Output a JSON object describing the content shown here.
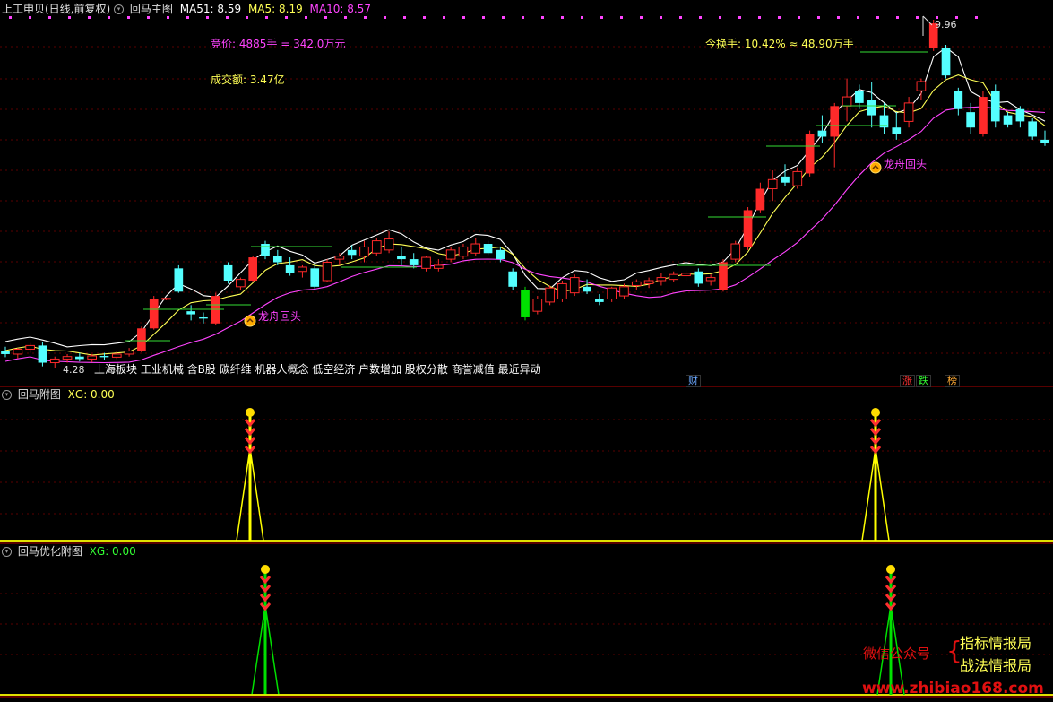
{
  "header": {
    "stock_title": "上工申贝(日线,前复权)",
    "indicator_name": "回马主图",
    "ma51_label": "MA51: 8.59",
    "ma5_label": "MA5: 8.19",
    "ma10_label": "MA10: 8.57"
  },
  "main_panel": {
    "auction": "竞价: 4885手 = 342.0万元",
    "turnover_amount": "成交额: 3.47亿",
    "turnover_rate": "今换手: 10.42% ≈ 48.90万手",
    "high_price": "9.96",
    "low_price": "4.28",
    "concepts": "上海板块 工业机械 含B股 碳纤维 机器人概念 低空经济 户数增加 股权分散 商誉减值 最近异动",
    "signal_label_1": "龙舟回头",
    "signal_label_2": "龙舟回头",
    "badge_cai": "财",
    "badge_zhang": "涨",
    "badge_die": "跌",
    "badge_bang": "榜"
  },
  "sub_panel_1": {
    "title": "回马附图",
    "xg_label": "XG: 0.00"
  },
  "sub_panel_2": {
    "title": "回马优化附图",
    "xg_label": "XG: 0.00"
  },
  "watermark": {
    "wechat_label": "微信公众号",
    "name_1": "指标情报局",
    "name_2": "战法情报局",
    "url": "www.zhibiao168.com"
  },
  "colors": {
    "up": "#ff2a2a",
    "down": "#54ffff",
    "big_down": "#00e000",
    "ma5": "#ffffff",
    "ma10": "#ffff55",
    "ma51": "#ff44ff",
    "signal": "#ffff00",
    "signal2": "#00e000"
  },
  "chart_data": {
    "type": "candlestick",
    "title": "上工申贝(日线,前复权)",
    "price_range": [
      4.28,
      9.96
    ],
    "candles": [
      [
        4.55,
        4.62,
        4.45,
        4.5
      ],
      [
        4.5,
        4.6,
        4.43,
        4.58
      ],
      [
        4.58,
        4.68,
        4.52,
        4.64
      ],
      [
        4.64,
        4.7,
        4.3,
        4.36
      ],
      [
        4.36,
        4.46,
        4.28,
        4.42
      ],
      [
        4.42,
        4.5,
        4.36,
        4.46
      ],
      [
        4.46,
        4.52,
        4.38,
        4.42
      ],
      [
        4.42,
        4.5,
        4.37,
        4.47
      ],
      [
        4.47,
        4.52,
        4.4,
        4.45
      ],
      [
        4.45,
        4.55,
        4.42,
        4.5
      ],
      [
        4.5,
        4.6,
        4.46,
        4.55
      ],
      [
        4.55,
        4.95,
        4.53,
        4.92
      ],
      [
        4.92,
        5.45,
        4.9,
        5.4
      ],
      [
        5.4,
        5.42,
        5.38,
        5.41
      ],
      [
        5.9,
        5.95,
        5.5,
        5.52
      ],
      [
        5.2,
        5.3,
        5.05,
        5.15
      ],
      [
        5.1,
        5.18,
        5.0,
        5.08
      ],
      [
        5.0,
        5.5,
        4.98,
        5.45
      ],
      [
        5.95,
        6.0,
        5.65,
        5.7
      ],
      [
        5.6,
        5.75,
        5.55,
        5.72
      ],
      [
        5.7,
        6.1,
        5.68,
        6.08
      ],
      [
        6.3,
        6.35,
        6.05,
        6.1
      ],
      [
        6.1,
        6.2,
        5.95,
        6.0
      ],
      [
        5.95,
        6.08,
        5.78,
        5.82
      ],
      [
        5.85,
        5.95,
        5.75,
        5.92
      ],
      [
        5.9,
        5.98,
        5.55,
        5.6
      ],
      [
        5.7,
        6.05,
        5.68,
        6.0
      ],
      [
        6.05,
        6.15,
        5.95,
        6.1
      ],
      [
        6.2,
        6.28,
        6.05,
        6.12
      ],
      [
        6.1,
        6.35,
        6.0,
        6.25
      ],
      [
        6.15,
        6.4,
        6.1,
        6.35
      ],
      [
        6.2,
        6.5,
        6.15,
        6.38
      ],
      [
        6.1,
        6.25,
        5.95,
        6.05
      ],
      [
        6.05,
        6.15,
        5.9,
        5.95
      ],
      [
        5.9,
        6.1,
        5.85,
        6.08
      ],
      [
        5.9,
        6.05,
        5.85,
        5.95
      ],
      [
        6.05,
        6.25,
        6.0,
        6.2
      ],
      [
        6.1,
        6.3,
        6.05,
        6.25
      ],
      [
        6.15,
        6.4,
        6.1,
        6.3
      ],
      [
        6.3,
        6.35,
        6.12,
        6.15
      ],
      [
        6.2,
        6.25,
        6.0,
        6.05
      ],
      [
        5.85,
        5.9,
        5.55,
        5.6
      ],
      [
        5.55,
        5.6,
        5.05,
        5.1
      ],
      [
        5.2,
        5.45,
        5.15,
        5.4
      ],
      [
        5.35,
        5.62,
        5.3,
        5.58
      ],
      [
        5.4,
        5.7,
        5.35,
        5.65
      ],
      [
        5.5,
        5.8,
        5.45,
        5.75
      ],
      [
        5.6,
        5.72,
        5.48,
        5.52
      ],
      [
        5.4,
        5.48,
        5.3,
        5.35
      ],
      [
        5.4,
        5.6,
        5.35,
        5.58
      ],
      [
        5.45,
        5.65,
        5.4,
        5.6
      ],
      [
        5.62,
        5.72,
        5.55,
        5.68
      ],
      [
        5.65,
        5.75,
        5.58,
        5.7
      ],
      [
        5.7,
        5.82,
        5.62,
        5.75
      ],
      [
        5.72,
        5.85,
        5.68,
        5.8
      ],
      [
        5.78,
        5.88,
        5.7,
        5.82
      ],
      [
        5.85,
        5.9,
        5.6,
        5.65
      ],
      [
        5.7,
        5.8,
        5.62,
        5.75
      ],
      [
        5.55,
        6.05,
        5.52,
        6.0
      ],
      [
        6.05,
        6.35,
        6.0,
        6.3
      ],
      [
        6.25,
        6.9,
        6.2,
        6.85
      ],
      [
        6.85,
        7.3,
        6.8,
        7.2
      ],
      [
        7.2,
        7.5,
        7.0,
        7.35
      ],
      [
        7.4,
        7.6,
        7.25,
        7.3
      ],
      [
        7.25,
        7.55,
        7.2,
        7.48
      ],
      [
        7.45,
        8.15,
        7.4,
        8.1
      ],
      [
        8.15,
        8.4,
        7.95,
        8.05
      ],
      [
        8.05,
        8.6,
        7.55,
        8.55
      ],
      [
        8.55,
        9.0,
        8.3,
        8.7
      ],
      [
        8.8,
        8.9,
        8.5,
        8.6
      ],
      [
        8.65,
        8.95,
        8.2,
        8.4
      ],
      [
        8.4,
        8.6,
        8.1,
        8.2
      ],
      [
        8.2,
        8.45,
        8.0,
        8.1
      ],
      [
        8.3,
        8.7,
        8.2,
        8.6
      ],
      [
        8.8,
        9.0,
        8.65,
        8.95
      ],
      [
        9.5,
        9.96,
        9.45,
        9.9
      ],
      [
        9.5,
        9.55,
        9.0,
        9.05
      ],
      [
        8.8,
        8.85,
        8.4,
        8.5
      ],
      [
        8.45,
        8.6,
        8.1,
        8.2
      ],
      [
        8.1,
        8.8,
        8.05,
        8.7
      ],
      [
        8.8,
        8.9,
        8.2,
        8.3
      ],
      [
        8.4,
        8.45,
        8.2,
        8.25
      ],
      [
        8.5,
        8.55,
        8.2,
        8.3
      ],
      [
        8.3,
        8.35,
        8.0,
        8.05
      ],
      [
        8.0,
        8.15,
        7.9,
        7.95
      ]
    ],
    "signals": [
      "龙舟回头",
      "龙舟回头"
    ]
  }
}
